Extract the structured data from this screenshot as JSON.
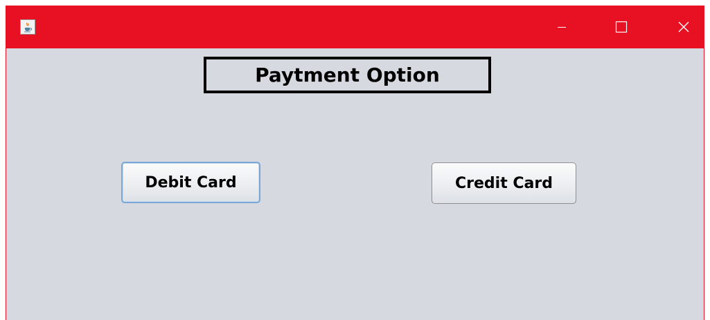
{
  "window": {
    "titlebar_color": "#e81123",
    "background_color": "#d6d9e0",
    "app_icon": "java-cup-icon",
    "controls": {
      "minimize": "minimize-icon",
      "maximize": "maximize-icon",
      "close": "close-icon"
    }
  },
  "main": {
    "heading": "Paytment Option",
    "buttons": {
      "debit_label": "Debit Card",
      "credit_label": "Credit Card"
    }
  }
}
